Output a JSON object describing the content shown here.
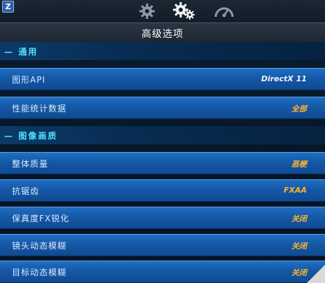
{
  "corner_button": {
    "label": "Z"
  },
  "tabs": [
    {
      "name": "general",
      "icon": "gear-icon",
      "active": false
    },
    {
      "name": "advanced",
      "icon": "double-gear-icon",
      "active": true
    },
    {
      "name": "performance",
      "icon": "speedometer-icon",
      "active": false
    }
  ],
  "title": "高级选项",
  "sections": [
    {
      "label": "通用",
      "rows": [
        {
          "label": "图形API",
          "value": "DirectX 11"
        },
        {
          "label": "性能统计数据",
          "value": "全部"
        }
      ]
    },
    {
      "label": "图像画质",
      "rows": [
        {
          "label": "整体质量",
          "value": "恶梗"
        },
        {
          "label": "抗锯齿",
          "value": "FXAA"
        },
        {
          "label": "保真度FX锐化",
          "value": "关闭"
        },
        {
          "label": "镜头动态模糊",
          "value": "关闭"
        },
        {
          "label": "目标动态模糊",
          "value": "关闭"
        }
      ]
    }
  ],
  "colors": {
    "accent_value": "#ffb52e",
    "section_text": "#4fe0ff",
    "row_blue": "#1558a6"
  }
}
